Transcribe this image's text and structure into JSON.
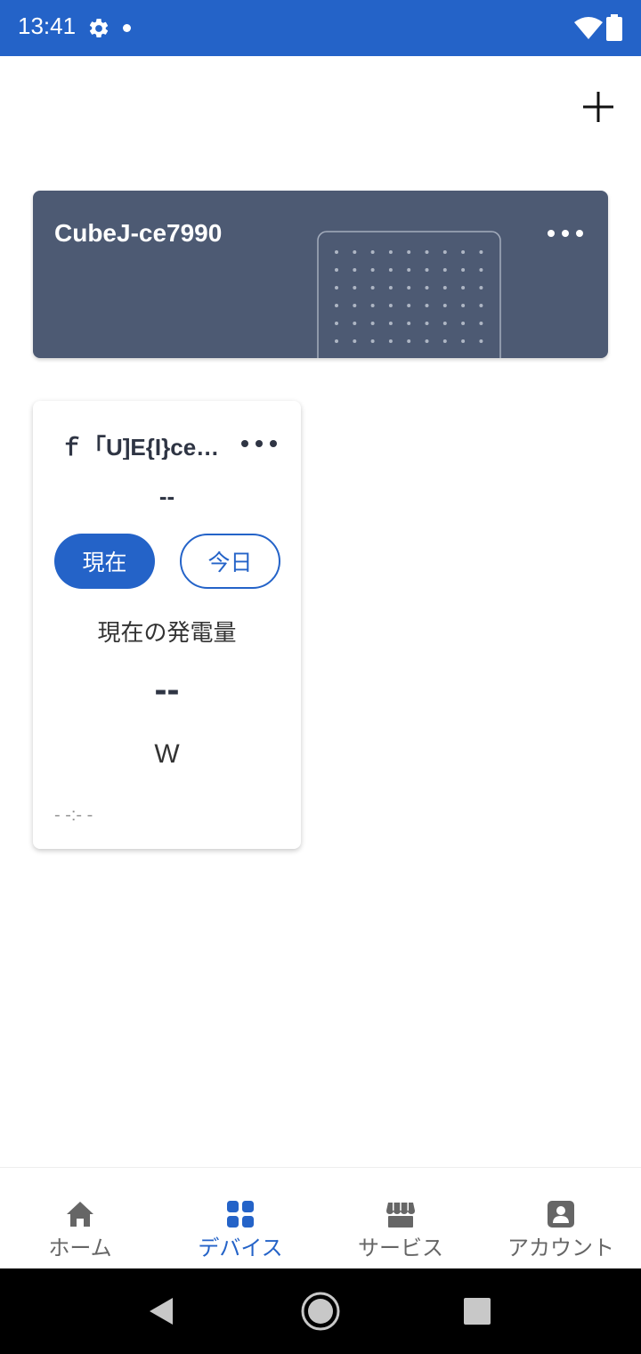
{
  "status_bar": {
    "time": "13:41",
    "icons": [
      "gear-icon",
      "notification-dot",
      "wifi-icon",
      "battery-icon"
    ]
  },
  "header": {
    "add_icon": "plus-icon"
  },
  "device_card": {
    "title": "CubeJ-ce7990",
    "more_icon": "more-horizontal-icon",
    "illustration": "device-panel-illustration",
    "background_color": "#4d5a73"
  },
  "widget_card": {
    "title": "ｆ「U]E{I}ce…",
    "more_icon": "more-horizontal-icon",
    "status_value": "--",
    "segments": [
      {
        "label": "現在",
        "selected": true
      },
      {
        "label": "今日",
        "selected": false
      }
    ],
    "metric_label": "現在の発電量",
    "metric_value": "--",
    "metric_unit": "W",
    "updated_time": "- -:- -"
  },
  "bottom_nav": {
    "items": [
      {
        "label": "ホーム",
        "icon": "home-icon",
        "active": false
      },
      {
        "label": "デバイス",
        "icon": "grid-icon",
        "active": true
      },
      {
        "label": "サービス",
        "icon": "store-icon",
        "active": false
      },
      {
        "label": "アカウント",
        "icon": "account-icon",
        "active": false
      }
    ]
  },
  "system_nav": {
    "icons": [
      "back-icon",
      "home-circle-icon",
      "recents-icon"
    ]
  },
  "colors": {
    "accent": "#2463c8",
    "text_dark": "#2f3544",
    "nav_inactive": "#666666"
  }
}
